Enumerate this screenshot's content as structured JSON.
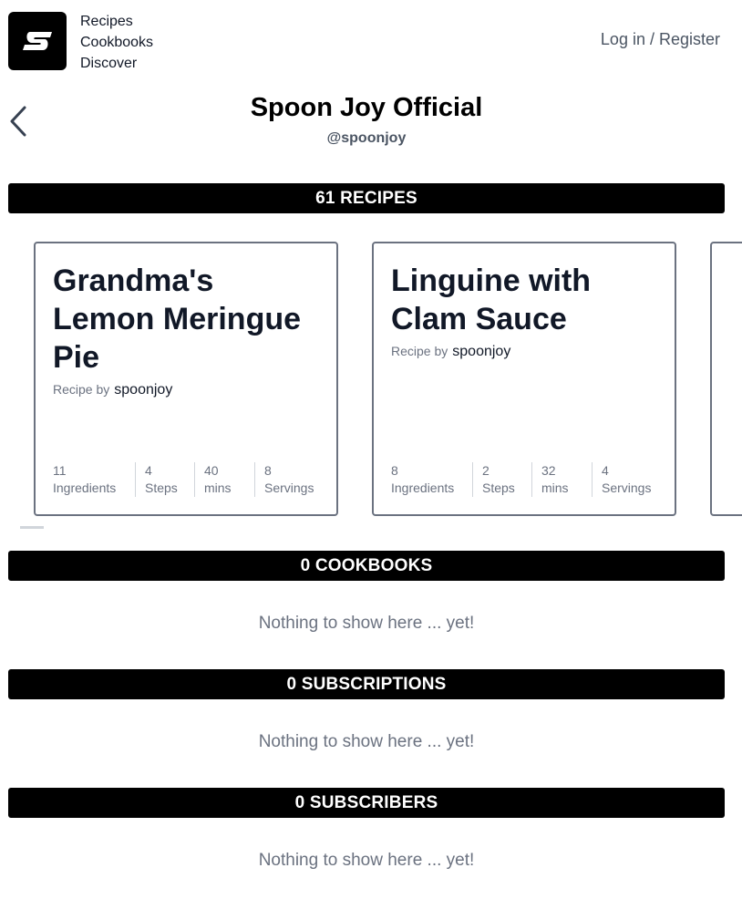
{
  "header": {
    "nav": [
      "Recipes",
      "Cookbooks",
      "Discover"
    ],
    "login_label": "Log in / Register"
  },
  "profile": {
    "name": "Spoon Joy Official",
    "handle": "@spoonjoy"
  },
  "sections": {
    "recipes": "61 RECIPES",
    "cookbooks": "0 COOKBOOKS",
    "subscriptions": "0 SUBSCRIPTIONS",
    "subscribers": "0 SUBSCRIBERS"
  },
  "empty_text": "Nothing to show here ... yet!",
  "recipes": [
    {
      "title": "Grandma's Lemon Meringue Pie",
      "by_label": "Recipe by",
      "author": "spoonjoy",
      "stats": [
        {
          "value": "11",
          "label": "Ingredients"
        },
        {
          "value": "4",
          "label": "Steps"
        },
        {
          "value": "40",
          "label": "mins"
        },
        {
          "value": "8",
          "label": "Servings"
        }
      ]
    },
    {
      "title": "Linguine with Clam Sauce",
      "by_label": "Recipe by",
      "author": "spoonjoy",
      "stats": [
        {
          "value": "8",
          "label": "Ingredients"
        },
        {
          "value": "2",
          "label": "Steps"
        },
        {
          "value": "32",
          "label": "mins"
        },
        {
          "value": "4",
          "label": "Servings"
        }
      ]
    }
  ],
  "colors": {
    "bar": "#000000",
    "muted_text": "#6b7280",
    "card_border": "#6b7280"
  },
  "icons": {
    "logo": "spoonjoy-logo-icon",
    "back": "chevron-left-icon"
  }
}
